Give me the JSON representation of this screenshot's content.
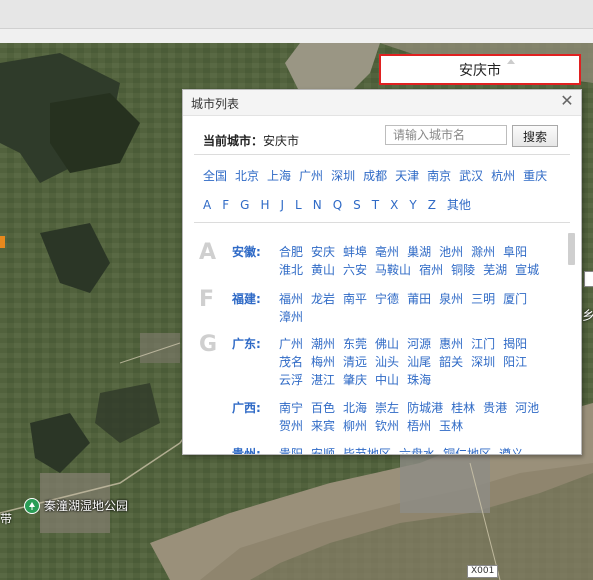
{
  "map": {
    "poi_label": "秦潼湖湿地公园",
    "left_tag": "带",
    "right_tag": "乡",
    "road_label": "X001"
  },
  "city_selector": {
    "value": "安庆市"
  },
  "panel": {
    "title": "城市列表",
    "close": "✕",
    "current_label": "当前城市：",
    "current_city": "安庆市",
    "search_placeholder": "请输入城市名",
    "search_button": "搜索",
    "hot_cities": [
      "全国",
      "北京",
      "上海",
      "广州",
      "深圳",
      "成都",
      "天津",
      "南京",
      "武汉",
      "杭州",
      "重庆"
    ],
    "letters": [
      "A",
      "F",
      "G",
      "H",
      "J",
      "L",
      "N",
      "Q",
      "S",
      "T",
      "X",
      "Y",
      "Z",
      "其他"
    ],
    "groups": [
      {
        "letter": "A",
        "province": "安徽:",
        "cities": [
          "合肥",
          "安庆",
          "蚌埠",
          "亳州",
          "巢湖",
          "池州",
          "滁州",
          "阜阳",
          "淮北",
          "黄山",
          "六安",
          "马鞍山",
          "宿州",
          "铜陵",
          "芜湖",
          "宣城"
        ]
      },
      {
        "letter": "F",
        "province": "福建:",
        "cities": [
          "福州",
          "龙岩",
          "南平",
          "宁德",
          "莆田",
          "泉州",
          "三明",
          "厦门",
          "漳州"
        ]
      },
      {
        "letter": "G",
        "province": "广东:",
        "cities": [
          "广州",
          "潮州",
          "东莞",
          "佛山",
          "河源",
          "惠州",
          "江门",
          "揭阳",
          "茂名",
          "梅州",
          "清远",
          "汕头",
          "汕尾",
          "韶关",
          "深圳",
          "阳江",
          "云浮",
          "湛江",
          "肇庆",
          "中山",
          "珠海"
        ]
      },
      {
        "letter": "",
        "province": "广西:",
        "cities": [
          "南宁",
          "百色",
          "北海",
          "崇左",
          "防城港",
          "桂林",
          "贵港",
          "河池",
          "贺州",
          "来宾",
          "柳州",
          "钦州",
          "梧州",
          "玉林"
        ]
      },
      {
        "letter": "",
        "province": "贵州:",
        "cities": [
          "贵阳",
          "安顺",
          "毕节地区",
          "六盘水",
          "铜仁地区",
          "遵义"
        ]
      }
    ]
  }
}
